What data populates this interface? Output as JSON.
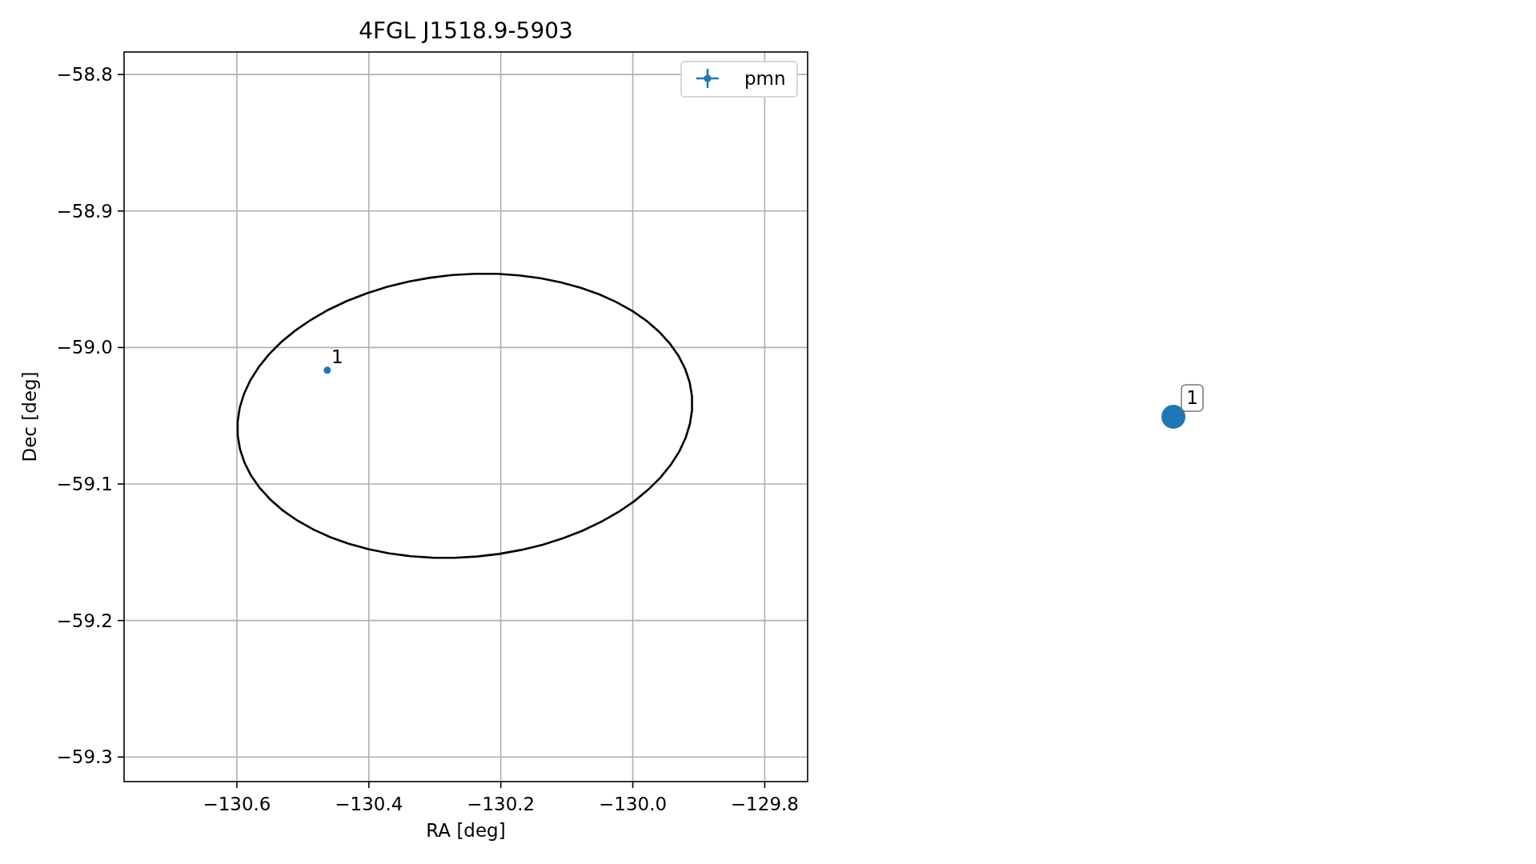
{
  "figure": {
    "chart_data": {
      "type": "scatter",
      "title": "4FGL J1518.9-5903",
      "xlabel": "RA [deg]",
      "ylabel": "Dec [deg]",
      "x": [
        -130.463
      ],
      "series": [
        {
          "name": "pmn",
          "color": "#1f77b4",
          "values": [
            -59.0166
          ]
        }
      ],
      "xlim": [
        -130.771,
        -129.735
      ],
      "ylim": [
        -59.318,
        -58.7835
      ],
      "xticks": [
        {
          "value": -130.6,
          "label": "−130.6"
        },
        {
          "value": -130.4,
          "label": "−130.4"
        },
        {
          "value": -130.2,
          "label": "−130.2"
        },
        {
          "value": -130.0,
          "label": "−130.0"
        },
        {
          "value": -129.8,
          "label": "−129.8"
        }
      ],
      "yticks": [
        {
          "value": -58.8,
          "label": "−58.8"
        },
        {
          "value": -58.9,
          "label": "−58.9"
        },
        {
          "value": -59.0,
          "label": "−59.0"
        },
        {
          "value": -59.1,
          "label": "−59.1"
        },
        {
          "value": -59.2,
          "label": "−59.2"
        },
        {
          "value": -59.3,
          "label": "−59.3"
        }
      ],
      "annotations": [
        "1"
      ],
      "grid": true
    }
  },
  "marker_panel": {
    "label": "1",
    "color": "#1f77b4"
  }
}
